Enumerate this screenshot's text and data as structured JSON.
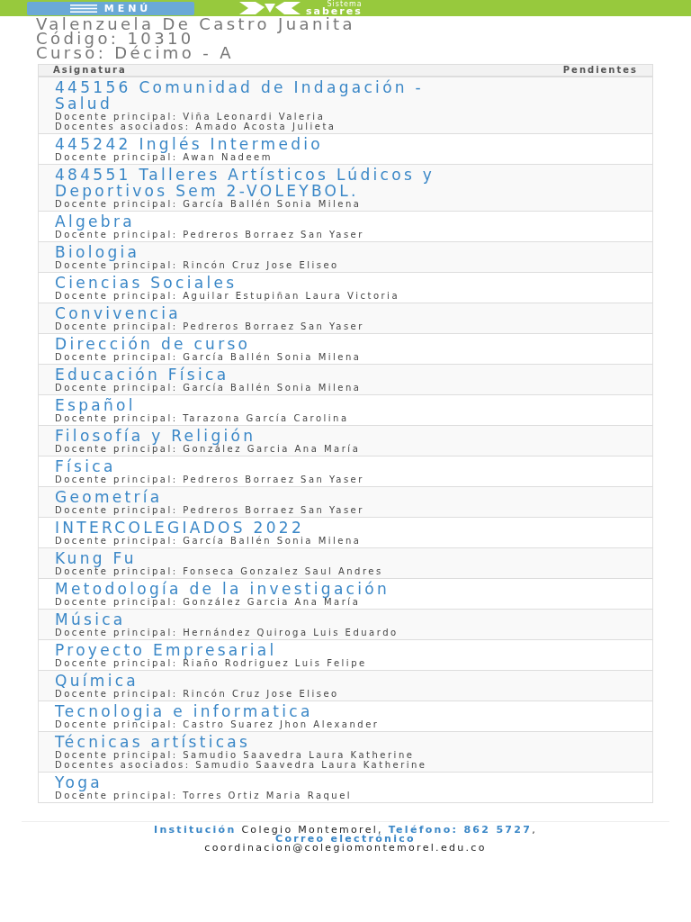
{
  "header": {
    "menu_button": "MENÚ",
    "logo_top": "Sistema",
    "logo_bottom": "saberes"
  },
  "student": {
    "name": "Valenzuela De Castro Juanita",
    "code": "Código: 10310",
    "course": "Curso: Décimo - A"
  },
  "table": {
    "columns": [
      "Asignatura",
      "Pendientes"
    ],
    "rows": [
      {
        "subject": "445156 Comunidad de Indagación - Salud",
        "teachers": [
          "Docente principal: Viña Leonardi Valeria",
          "Docentes asociados: Amado Acosta Julieta"
        ]
      },
      {
        "subject": "445242 Inglés Intermedio",
        "teachers": [
          "Docente principal: Awan Nadeem"
        ]
      },
      {
        "subject": "484551 Talleres Artísticos Lúdicos y Deportivos Sem 2-VOLEYBOL.",
        "teachers": [
          "Docente principal: García Ballén Sonia Milena"
        ]
      },
      {
        "subject": "Algebra",
        "teachers": [
          "Docente principal: Pedreros Borraez San Yaser"
        ]
      },
      {
        "subject": "Biologia",
        "teachers": [
          "Docente principal: Rincón Cruz Jose Eliseo"
        ]
      },
      {
        "subject": "Ciencias Sociales",
        "teachers": [
          "Docente principal: Aguilar Estupiñan Laura Victoria"
        ]
      },
      {
        "subject": "Convivencia",
        "teachers": [
          "Docente principal: Pedreros Borraez San Yaser"
        ]
      },
      {
        "subject": "Dirección de curso",
        "teachers": [
          "Docente principal: García Ballén Sonia Milena"
        ]
      },
      {
        "subject": "Educación Física",
        "teachers": [
          "Docente principal: García Ballén Sonia Milena"
        ]
      },
      {
        "subject": "Español",
        "teachers": [
          "Docente principal: Tarazona García Carolina"
        ]
      },
      {
        "subject": "Filosofía y Religión",
        "teachers": [
          "Docente principal: González Garcia Ana María"
        ]
      },
      {
        "subject": "Física",
        "teachers": [
          "Docente principal: Pedreros Borraez San Yaser"
        ]
      },
      {
        "subject": "Geometría",
        "teachers": [
          "Docente principal: Pedreros Borraez San Yaser"
        ]
      },
      {
        "subject": "INTERCOLEGIADOS 2022",
        "teachers": [
          "Docente principal: García Ballén Sonia Milena"
        ]
      },
      {
        "subject": "Kung Fu",
        "teachers": [
          "Docente principal: Fonseca Gonzalez Saul Andres"
        ]
      },
      {
        "subject": "Metodología de la investigación",
        "teachers": [
          "Docente principal: González Garcia Ana María"
        ]
      },
      {
        "subject": "Música",
        "teachers": [
          "Docente principal: Hernández Quiroga Luis Eduardo"
        ]
      },
      {
        "subject": "Proyecto Empresarial",
        "teachers": [
          "Docente principal: Riaño Rodriguez Luis Felipe"
        ]
      },
      {
        "subject": "Química",
        "teachers": [
          "Docente principal: Rincón Cruz Jose Eliseo"
        ]
      },
      {
        "subject": "Tecnologia e informatica",
        "teachers": [
          "Docente principal: Castro Suarez Jhon Alexander"
        ]
      },
      {
        "subject": "Técnicas artísticas",
        "teachers": [
          "Docente principal: Samudio Saavedra Laura Katherine",
          "Docentes asociados: Samudio Saavedra Laura Katherine"
        ]
      },
      {
        "subject": "Yoga",
        "teachers": [
          "Docente principal: Torres Ortiz Maria Raquel"
        ]
      }
    ]
  },
  "footer": {
    "institution_label": "Institución",
    "institution": "Colegio Montemorel,",
    "phone": "Teléfono: 862 5727",
    "comma": ",",
    "email_label": "Correo electrónico",
    "email": "coordinacion@colegiomontemorel.edu.co"
  }
}
